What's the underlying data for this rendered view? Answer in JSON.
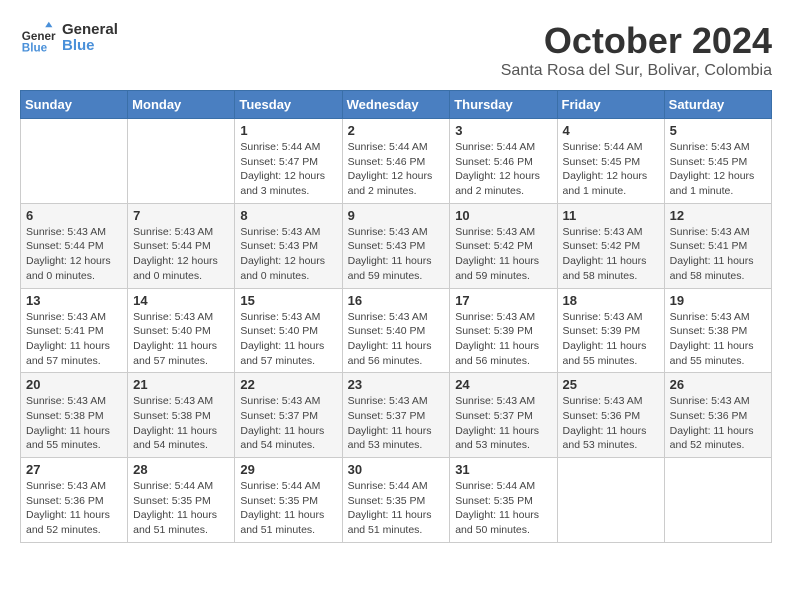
{
  "logo": {
    "line1": "General",
    "line2": "Blue"
  },
  "title": "October 2024",
  "location": "Santa Rosa del Sur, Bolivar, Colombia",
  "days_header": [
    "Sunday",
    "Monday",
    "Tuesday",
    "Wednesday",
    "Thursday",
    "Friday",
    "Saturday"
  ],
  "weeks": [
    [
      {
        "day": "",
        "info": ""
      },
      {
        "day": "",
        "info": ""
      },
      {
        "day": "1",
        "info": "Sunrise: 5:44 AM\nSunset: 5:47 PM\nDaylight: 12 hours and 3 minutes."
      },
      {
        "day": "2",
        "info": "Sunrise: 5:44 AM\nSunset: 5:46 PM\nDaylight: 12 hours and 2 minutes."
      },
      {
        "day": "3",
        "info": "Sunrise: 5:44 AM\nSunset: 5:46 PM\nDaylight: 12 hours and 2 minutes."
      },
      {
        "day": "4",
        "info": "Sunrise: 5:44 AM\nSunset: 5:45 PM\nDaylight: 12 hours and 1 minute."
      },
      {
        "day": "5",
        "info": "Sunrise: 5:43 AM\nSunset: 5:45 PM\nDaylight: 12 hours and 1 minute."
      }
    ],
    [
      {
        "day": "6",
        "info": "Sunrise: 5:43 AM\nSunset: 5:44 PM\nDaylight: 12 hours and 0 minutes."
      },
      {
        "day": "7",
        "info": "Sunrise: 5:43 AM\nSunset: 5:44 PM\nDaylight: 12 hours and 0 minutes."
      },
      {
        "day": "8",
        "info": "Sunrise: 5:43 AM\nSunset: 5:43 PM\nDaylight: 12 hours and 0 minutes."
      },
      {
        "day": "9",
        "info": "Sunrise: 5:43 AM\nSunset: 5:43 PM\nDaylight: 11 hours and 59 minutes."
      },
      {
        "day": "10",
        "info": "Sunrise: 5:43 AM\nSunset: 5:42 PM\nDaylight: 11 hours and 59 minutes."
      },
      {
        "day": "11",
        "info": "Sunrise: 5:43 AM\nSunset: 5:42 PM\nDaylight: 11 hours and 58 minutes."
      },
      {
        "day": "12",
        "info": "Sunrise: 5:43 AM\nSunset: 5:41 PM\nDaylight: 11 hours and 58 minutes."
      }
    ],
    [
      {
        "day": "13",
        "info": "Sunrise: 5:43 AM\nSunset: 5:41 PM\nDaylight: 11 hours and 57 minutes."
      },
      {
        "day": "14",
        "info": "Sunrise: 5:43 AM\nSunset: 5:40 PM\nDaylight: 11 hours and 57 minutes."
      },
      {
        "day": "15",
        "info": "Sunrise: 5:43 AM\nSunset: 5:40 PM\nDaylight: 11 hours and 57 minutes."
      },
      {
        "day": "16",
        "info": "Sunrise: 5:43 AM\nSunset: 5:40 PM\nDaylight: 11 hours and 56 minutes."
      },
      {
        "day": "17",
        "info": "Sunrise: 5:43 AM\nSunset: 5:39 PM\nDaylight: 11 hours and 56 minutes."
      },
      {
        "day": "18",
        "info": "Sunrise: 5:43 AM\nSunset: 5:39 PM\nDaylight: 11 hours and 55 minutes."
      },
      {
        "day": "19",
        "info": "Sunrise: 5:43 AM\nSunset: 5:38 PM\nDaylight: 11 hours and 55 minutes."
      }
    ],
    [
      {
        "day": "20",
        "info": "Sunrise: 5:43 AM\nSunset: 5:38 PM\nDaylight: 11 hours and 55 minutes."
      },
      {
        "day": "21",
        "info": "Sunrise: 5:43 AM\nSunset: 5:38 PM\nDaylight: 11 hours and 54 minutes."
      },
      {
        "day": "22",
        "info": "Sunrise: 5:43 AM\nSunset: 5:37 PM\nDaylight: 11 hours and 54 minutes."
      },
      {
        "day": "23",
        "info": "Sunrise: 5:43 AM\nSunset: 5:37 PM\nDaylight: 11 hours and 53 minutes."
      },
      {
        "day": "24",
        "info": "Sunrise: 5:43 AM\nSunset: 5:37 PM\nDaylight: 11 hours and 53 minutes."
      },
      {
        "day": "25",
        "info": "Sunrise: 5:43 AM\nSunset: 5:36 PM\nDaylight: 11 hours and 53 minutes."
      },
      {
        "day": "26",
        "info": "Sunrise: 5:43 AM\nSunset: 5:36 PM\nDaylight: 11 hours and 52 minutes."
      }
    ],
    [
      {
        "day": "27",
        "info": "Sunrise: 5:43 AM\nSunset: 5:36 PM\nDaylight: 11 hours and 52 minutes."
      },
      {
        "day": "28",
        "info": "Sunrise: 5:44 AM\nSunset: 5:35 PM\nDaylight: 11 hours and 51 minutes."
      },
      {
        "day": "29",
        "info": "Sunrise: 5:44 AM\nSunset: 5:35 PM\nDaylight: 11 hours and 51 minutes."
      },
      {
        "day": "30",
        "info": "Sunrise: 5:44 AM\nSunset: 5:35 PM\nDaylight: 11 hours and 51 minutes."
      },
      {
        "day": "31",
        "info": "Sunrise: 5:44 AM\nSunset: 5:35 PM\nDaylight: 11 hours and 50 minutes."
      },
      {
        "day": "",
        "info": ""
      },
      {
        "day": "",
        "info": ""
      }
    ]
  ]
}
